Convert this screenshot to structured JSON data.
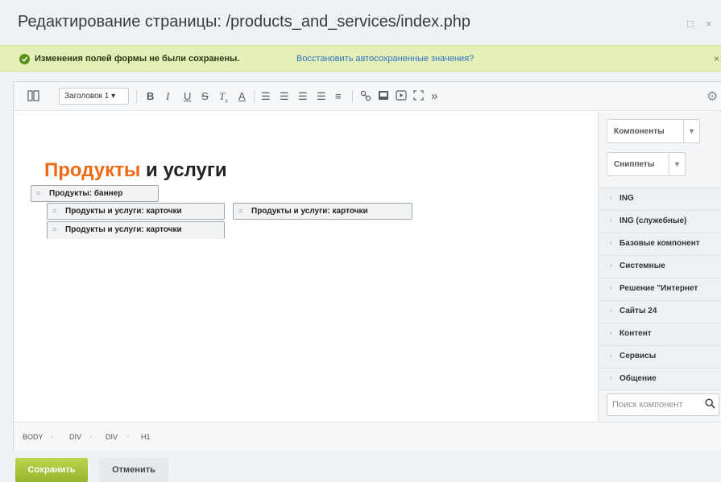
{
  "window": {
    "title": "Редактирование страницы: /products_and_services/index.php",
    "buttons": {
      "maximize": "□",
      "close": "×"
    }
  },
  "notice": {
    "message": "Изменения полей формы не были сохранены.",
    "restore_link": "Восстановить автосохраненные значения?",
    "close": "×",
    "color": "#e5f0b9"
  },
  "toolbar": {
    "heading_select": "Заголовок 1",
    "icons": [
      "view-mode-icon",
      "bold-icon",
      "italic-icon",
      "underline-icon",
      "strikethrough-icon",
      "remove-format-icon",
      "text-color-icon",
      "ordered-list-icon",
      "unordered-list-icon",
      "outdent-icon",
      "indent-icon",
      "align-icon",
      "link-icon",
      "image-icon",
      "video-icon",
      "fullscreen-icon",
      "more-icon",
      "settings-icon"
    ]
  },
  "content": {
    "heading_accent": "Продукты",
    "heading_rest": " и услуги",
    "components": [
      "Продукты: баннер",
      "Продукты и услуги: карточки",
      "Продукты и услуги: карточки",
      "Продукты и услуги: карточки"
    ],
    "accent_color": "#f06a16"
  },
  "sidebar": {
    "components_button": "Компоненты",
    "snippets_button": "Сниппеты",
    "categories": [
      "ING",
      "ING (служебные)",
      "Базовые компонент",
      "Системные",
      "Решение \"Интернет",
      "Сайты 24",
      "Контент",
      "Сервисы",
      "Общение"
    ],
    "search_placeholder": "Поиск компонент"
  },
  "pathbar": {
    "crumbs": [
      "BODY",
      "DIV",
      "DIV",
      "H1"
    ]
  },
  "footer": {
    "save": "Сохранить",
    "cancel": "Отменить",
    "save_color": "#a6c53a"
  }
}
